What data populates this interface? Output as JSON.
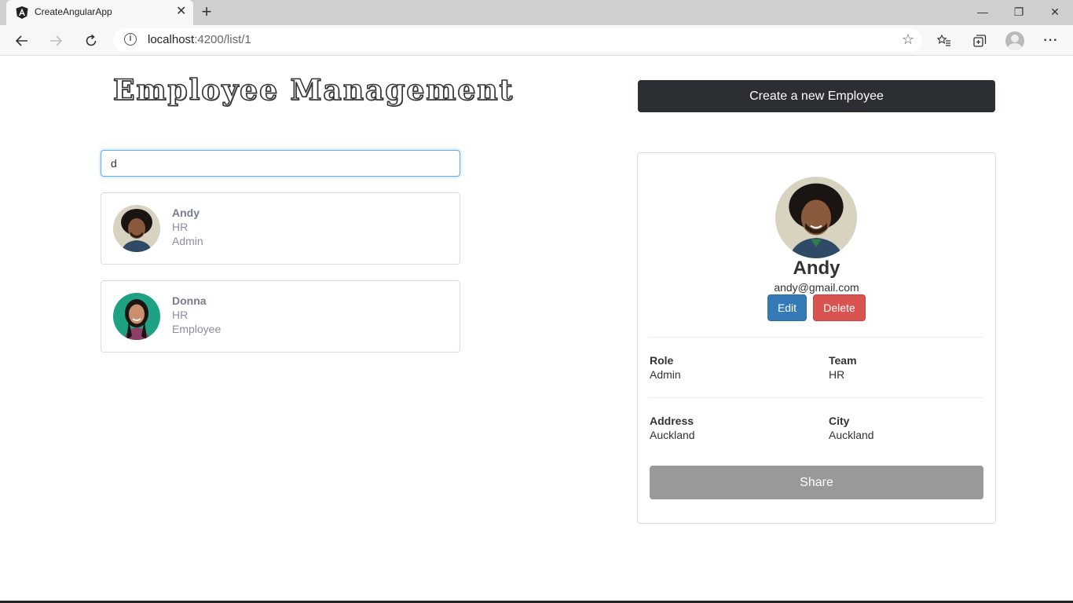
{
  "browser": {
    "tab_title": "CreateAngularApp",
    "tab_close": "✕",
    "new_tab": "+",
    "url_host": "localhost",
    "url_rest": ":4200/list/1",
    "window_controls": {
      "minimize": "—",
      "restore": "❐",
      "close": "✕"
    }
  },
  "header": {
    "title": "Employee Management",
    "create_button": "Create a new Employee"
  },
  "search": {
    "value": "d",
    "placeholder": ""
  },
  "employees": [
    {
      "name": "Andy",
      "team": "HR",
      "role": "Admin",
      "avatar_bg": "#d8d2c0"
    },
    {
      "name": "Donna",
      "team": "HR",
      "role": "Employee",
      "avatar_bg": "#1fa184"
    }
  ],
  "detail": {
    "name": "Andy",
    "email": "andy@gmail.com",
    "edit_label": "Edit",
    "delete_label": "Delete",
    "role_label": "Role",
    "role_value": "Admin",
    "team_label": "Team",
    "team_value": "HR",
    "address_label": "Address",
    "address_value": "Auckland",
    "city_label": "City",
    "city_value": "Auckland",
    "share_label": "Share"
  },
  "colors": {
    "primary": "#337ab7",
    "danger": "#d9534f",
    "dark": "#2b2f33",
    "share": "#999999"
  }
}
